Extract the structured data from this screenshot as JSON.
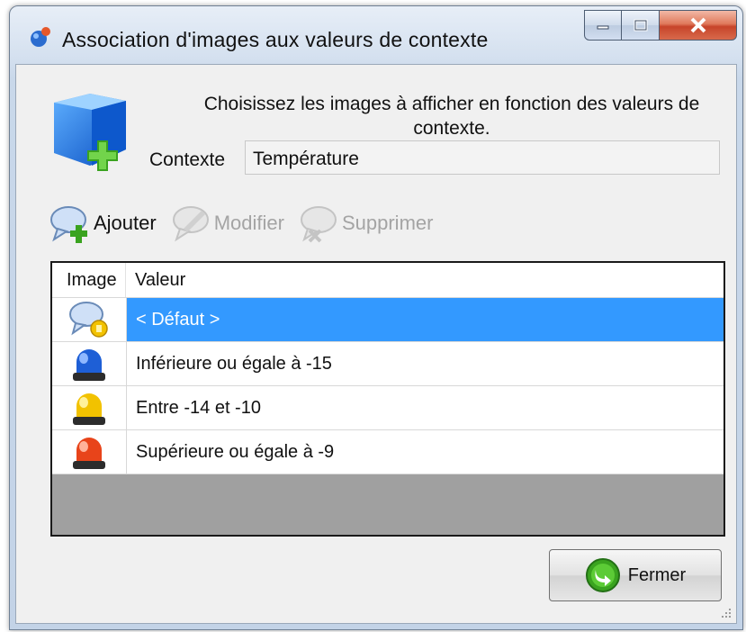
{
  "window": {
    "title": "Association d'images aux valeurs de contexte",
    "caption_buttons": [
      "minimize-icon",
      "maximize-icon",
      "close-icon"
    ]
  },
  "header": {
    "instruction": "Choisissez les images à afficher en fonction des valeurs de contexte.",
    "context_label": "Contexte",
    "context_value": "Température"
  },
  "toolbar": {
    "add_label": "Ajouter",
    "edit_label": "Modifier",
    "delete_label": "Supprimer",
    "add_enabled": true,
    "edit_enabled": false,
    "delete_enabled": false
  },
  "grid": {
    "columns": [
      "Image",
      "Valeur"
    ],
    "rows": [
      {
        "icon": "speech-bubble-key-icon",
        "value": "< Défaut >",
        "selected": true
      },
      {
        "icon": "blue-beacon-icon",
        "value": "Inférieure ou égale à -15",
        "selected": false
      },
      {
        "icon": "yellow-beacon-icon",
        "value": "Entre -14 et -10",
        "selected": false
      },
      {
        "icon": "red-beacon-icon",
        "value": "Supérieure ou égale à -9",
        "selected": false
      }
    ]
  },
  "footer": {
    "close_label": "Fermer"
  },
  "colors": {
    "selection": "#3399ff",
    "blue_beacon": "#1e5fd6",
    "yellow_beacon": "#f2c200",
    "red_beacon": "#e8441a"
  }
}
